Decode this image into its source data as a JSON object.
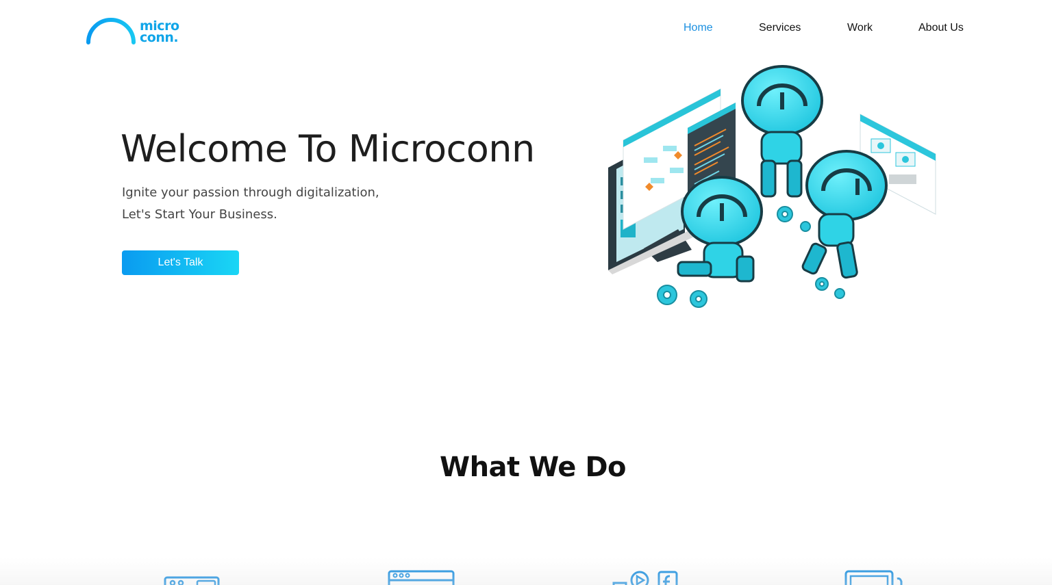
{
  "brand": {
    "line1": "micro",
    "line2": "conn.",
    "color": "#10a5e8"
  },
  "nav": {
    "items": [
      {
        "label": "Home",
        "active": true
      },
      {
        "label": "Services",
        "active": false
      },
      {
        "label": "Work",
        "active": false
      },
      {
        "label": "About Us",
        "active": false
      }
    ]
  },
  "hero": {
    "title": "Welcome To Microconn",
    "subtitle_line1": "Ignite your passion through digitalization,",
    "subtitle_line2": "Let's Start Your Business.",
    "cta_label": "Let's Talk"
  },
  "section": {
    "title": "What We Do"
  },
  "services": {
    "icons": [
      "ui-design-icon",
      "web-browser-icon",
      "social-media-icon",
      "laptop-icon"
    ]
  },
  "colors": {
    "accent": "#1a8fe0",
    "cyan": "#29d6ec",
    "dark_teal": "#1b4a55"
  }
}
